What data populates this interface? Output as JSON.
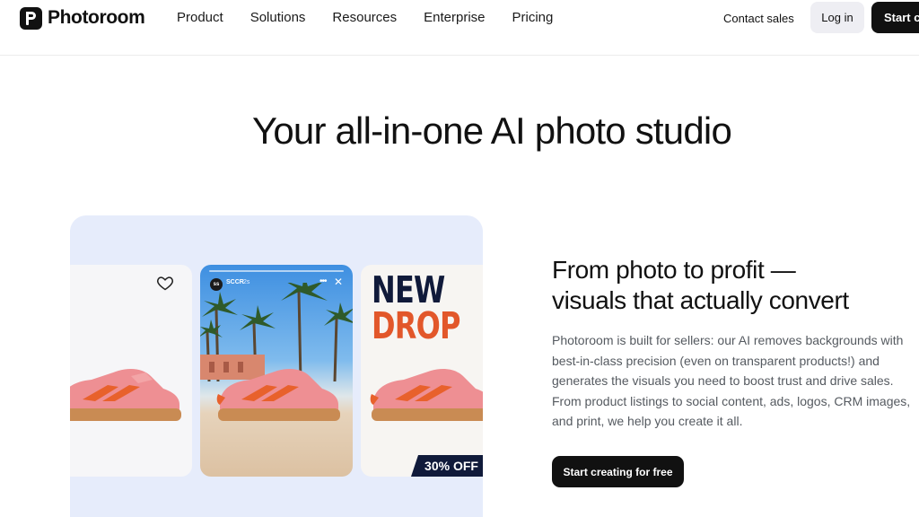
{
  "header": {
    "brand": "Photoroom",
    "nav": [
      "Product",
      "Solutions",
      "Resources",
      "Enterprise",
      "Pricing"
    ],
    "contact_label": "Contact sales",
    "login_label": "Log in",
    "start_label": "Start cr"
  },
  "hero": {
    "title": "Your all-in-one AI photo studio"
  },
  "showcase": {
    "story_user": "SCCR",
    "story_time": "2s",
    "promo_line1": "NEW",
    "promo_line2": "DROP",
    "promo_badge": "30% OFF",
    "colors": {
      "panel": "#e6ecfb",
      "shoe": "#ee8f93",
      "stripe": "#e8612c",
      "sole": "#c98b53",
      "navy": "#101a3a"
    }
  },
  "section": {
    "title_line1": "From photo to profit —",
    "title_line2": "visuals that actually convert",
    "description": "Photoroom is built for sellers: our AI removes backgrounds with best-in-class precision (even on transparent products!) and generates the visuals you need to boost trust and drive sales. From product listings to social content, ads, logos, CRM images, and print, we help you create it all.",
    "cta_label": "Start creating for free"
  }
}
